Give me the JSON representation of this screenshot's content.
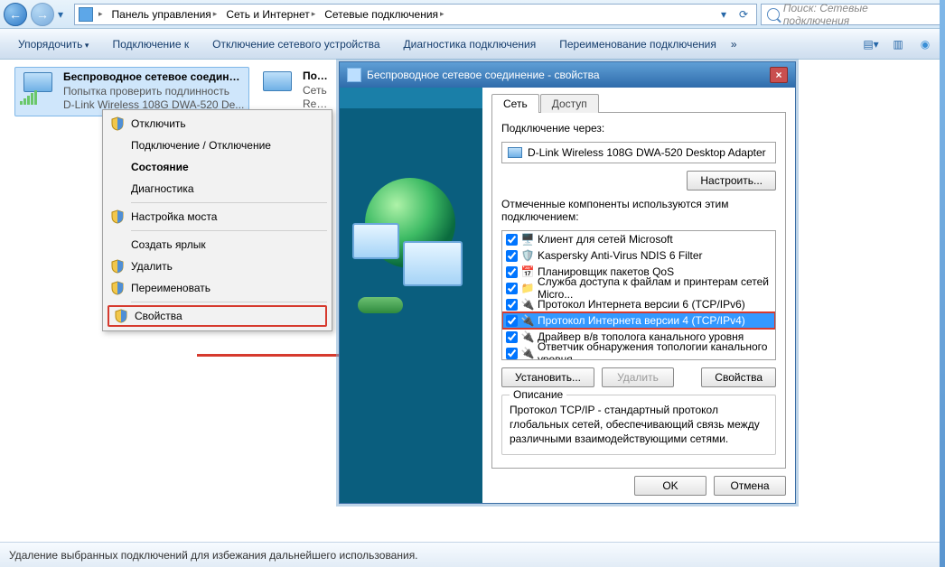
{
  "breadcrumb": {
    "b1": "Панель управления",
    "b2": "Сеть и Интернет",
    "b3": "Сетевые подключения"
  },
  "search_placeholder": "Поиск: Сетевые подключения",
  "cmdbar": {
    "organize": "Упорядочить",
    "connect": "Подключение к",
    "disable": "Отключение сетевого устройства",
    "diag": "Диагностика подключения",
    "rename": "Переименование подключения"
  },
  "tile1": {
    "title": "Беспроводное сетевое соединение",
    "line2": "Попытка проверить подлинность",
    "line3": "D-Link Wireless 108G DWA-520 De..."
  },
  "tile2": {
    "title": "Подкл...",
    "line2": "Сеть",
    "line3": "Realtek..."
  },
  "ctx": {
    "disable": "Отключить",
    "toggle": "Подключение / Отключение",
    "status": "Состояние",
    "diag": "Диагностика",
    "bridge": "Настройка моста",
    "shortcut": "Создать ярлык",
    "delete": "Удалить",
    "rename": "Переименовать",
    "props": "Свойства"
  },
  "dialog": {
    "title": "Беспроводное сетевое соединение - свойства",
    "tab1": "Сеть",
    "tab2": "Доступ",
    "connect_via": "Подключение через:",
    "adapter": "D-Link Wireless 108G DWA-520 Desktop Adapter",
    "configure": "Настроить...",
    "components_lbl": "Отмеченные компоненты используются этим подключением:",
    "components": [
      "Клиент для сетей Microsoft",
      "Kaspersky Anti-Virus NDIS 6 Filter",
      "Планировщик пакетов QoS",
      "Служба доступа к файлам и принтерам сетей Micro...",
      "Протокол Интернета версии 6 (TCP/IPv6)",
      "Протокол Интернета версии 4 (TCP/IPv4)",
      "Драйвер в/в тополога канального уровня",
      "Ответчик обнаружения топологии канального уровня"
    ],
    "install": "Установить...",
    "remove": "Удалить",
    "props": "Свойства",
    "desc_legend": "Описание",
    "desc": "Протокол TCP/IP - стандартный протокол глобальных сетей, обеспечивающий связь между различными взаимодействующими сетями.",
    "ok": "OK",
    "cancel": "Отмена"
  },
  "status": "Удаление выбранных подключений для избежания дальнейшего использования."
}
